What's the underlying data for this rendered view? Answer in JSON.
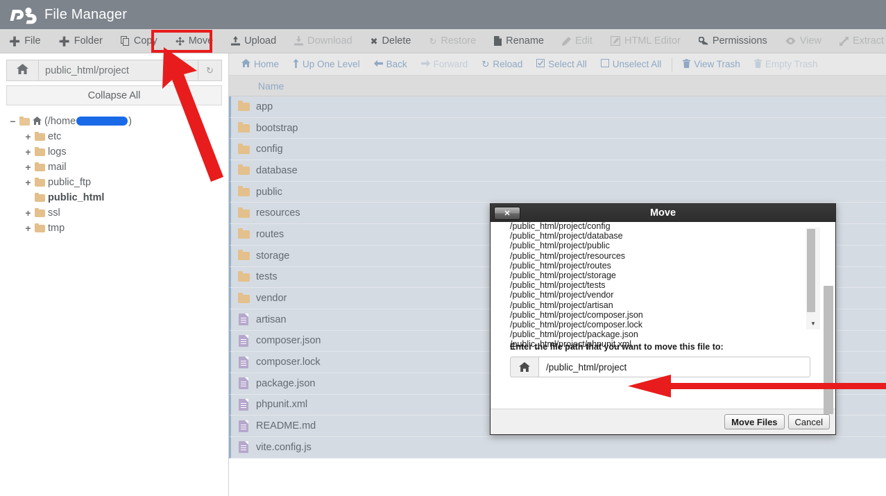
{
  "header": {
    "title": "File Manager",
    "logo_icon": "cpanel-logo-icon"
  },
  "toolbar": {
    "items": [
      {
        "label": "File",
        "icon": "plus-icon",
        "disabled": false
      },
      {
        "label": "Folder",
        "icon": "plus-icon",
        "disabled": false
      },
      {
        "label": "Copy",
        "icon": "copy-icon",
        "disabled": false
      },
      {
        "label": "Move",
        "icon": "move-arrows-icon",
        "disabled": false
      },
      {
        "label": "Upload",
        "icon": "upload-icon",
        "disabled": false
      },
      {
        "label": "Download",
        "icon": "download-icon",
        "disabled": true
      },
      {
        "label": "Delete",
        "icon": "x-mark-icon",
        "disabled": false
      },
      {
        "label": "Restore",
        "icon": "restore-arrow-icon",
        "disabled": true
      },
      {
        "label": "Rename",
        "icon": "file-icon",
        "disabled": false
      },
      {
        "label": "Edit",
        "icon": "pencil-icon",
        "disabled": true
      },
      {
        "label": "HTML Editor",
        "icon": "html-editor-icon",
        "disabled": true
      },
      {
        "label": "Permissions",
        "icon": "key-icon",
        "disabled": false
      },
      {
        "label": "View",
        "icon": "eye-icon",
        "disabled": true
      },
      {
        "label": "Extract",
        "icon": "expand-arrows-icon",
        "disabled": true
      }
    ]
  },
  "sidebar": {
    "path_value": "public_html/project",
    "path_home_icon": "home-icon",
    "path_go_icon": "go-icon",
    "collapse_all_label": "Collapse All",
    "tree": [
      {
        "label": "(/home",
        "label_suffix": ")",
        "toggle": "−",
        "icon": "home-folder-icon",
        "level": 1,
        "redacted": true,
        "bold": false
      },
      {
        "label": "etc",
        "toggle": "+",
        "icon": "folder-icon",
        "level": 2,
        "redacted": false,
        "bold": false
      },
      {
        "label": "logs",
        "toggle": "+",
        "icon": "folder-icon",
        "level": 2,
        "redacted": false,
        "bold": false
      },
      {
        "label": "mail",
        "toggle": "+",
        "icon": "folder-icon",
        "level": 2,
        "redacted": false,
        "bold": false
      },
      {
        "label": "public_ftp",
        "toggle": "+",
        "icon": "folder-icon",
        "level": 2,
        "redacted": false,
        "bold": false
      },
      {
        "label": "public_html",
        "toggle": "",
        "icon": "folder-icon",
        "level": 2,
        "redacted": false,
        "bold": true
      },
      {
        "label": "ssl",
        "toggle": "+",
        "icon": "folder-icon",
        "level": 2,
        "redacted": false,
        "bold": false
      },
      {
        "label": "tmp",
        "toggle": "+",
        "icon": "folder-icon",
        "level": 2,
        "redacted": false,
        "bold": false
      }
    ]
  },
  "subnav": {
    "items": [
      {
        "label": "Home",
        "icon": "home-icon",
        "disabled": false
      },
      {
        "label": "Up One Level",
        "icon": "up-arrow-icon",
        "disabled": false
      },
      {
        "label": "Back",
        "icon": "left-arrow-icon",
        "disabled": false
      },
      {
        "label": "Forward",
        "icon": "right-arrow-icon",
        "disabled": true
      },
      {
        "label": "Reload",
        "icon": "reload-icon",
        "disabled": false
      },
      {
        "label": "Select All",
        "icon": "checked-box-icon",
        "disabled": false
      },
      {
        "label": "Unselect All",
        "icon": "empty-box-icon",
        "disabled": false
      },
      {
        "label": "View Trash",
        "icon": "trash-icon",
        "disabled": false
      },
      {
        "label": "Empty Trash",
        "icon": "trash-icon",
        "disabled": true
      }
    ]
  },
  "file_list": {
    "column_header": "Name",
    "rows": [
      {
        "name": "app",
        "type": "folder",
        "selected": true
      },
      {
        "name": "bootstrap",
        "type": "folder",
        "selected": true
      },
      {
        "name": "config",
        "type": "folder",
        "selected": true
      },
      {
        "name": "database",
        "type": "folder",
        "selected": true
      },
      {
        "name": "public",
        "type": "folder",
        "selected": true
      },
      {
        "name": "resources",
        "type": "folder",
        "selected": true
      },
      {
        "name": "routes",
        "type": "folder",
        "selected": true
      },
      {
        "name": "storage",
        "type": "folder",
        "selected": true
      },
      {
        "name": "tests",
        "type": "folder",
        "selected": true
      },
      {
        "name": "vendor",
        "type": "folder",
        "selected": true
      },
      {
        "name": "artisan",
        "type": "file",
        "selected": true
      },
      {
        "name": "composer.json",
        "type": "file",
        "selected": true
      },
      {
        "name": "composer.lock",
        "type": "file",
        "selected": true
      },
      {
        "name": "package.json",
        "type": "file",
        "selected": true
      },
      {
        "name": "phpunit.xml",
        "type": "file",
        "selected": true
      },
      {
        "name": "README.md",
        "type": "file",
        "selected": true
      },
      {
        "name": "vite.config.js",
        "type": "file",
        "selected": true
      }
    ]
  },
  "move_dialog": {
    "title": "Move",
    "close_icon": "close-x-icon",
    "paths": [
      "/public_html/project/config",
      "/public_html/project/database",
      "/public_html/project/public",
      "/public_html/project/resources",
      "/public_html/project/routes",
      "/public_html/project/storage",
      "/public_html/project/tests",
      "/public_html/project/vendor",
      "/public_html/project/artisan",
      "/public_html/project/composer.json",
      "/public_html/project/composer.lock",
      "/public_html/project/package.json",
      "/public_html/project/phpunit.xml"
    ],
    "form_label": "Enter the file path that you want to move this file to:",
    "input_value": "/public_html/project",
    "input_home_icon": "home-icon",
    "confirm_label": "Move Files",
    "cancel_label": "Cancel",
    "scroll_up_icon": "triangle-up-icon",
    "scroll_down_icon": "triangle-down-icon"
  },
  "annotations": {
    "highlight_color": "#e81c1c",
    "arrow_color": "#e81c1c",
    "redaction_color": "#1a6ae8"
  },
  "colors": {
    "header_bg": "#7d848c",
    "toolbar_bg": "#d9d9d9",
    "row_selected_bg": "#d5dbe2",
    "subnav_link": "#8fa8c4",
    "folder": "#e3c08c",
    "file": "#b5a8cc"
  }
}
